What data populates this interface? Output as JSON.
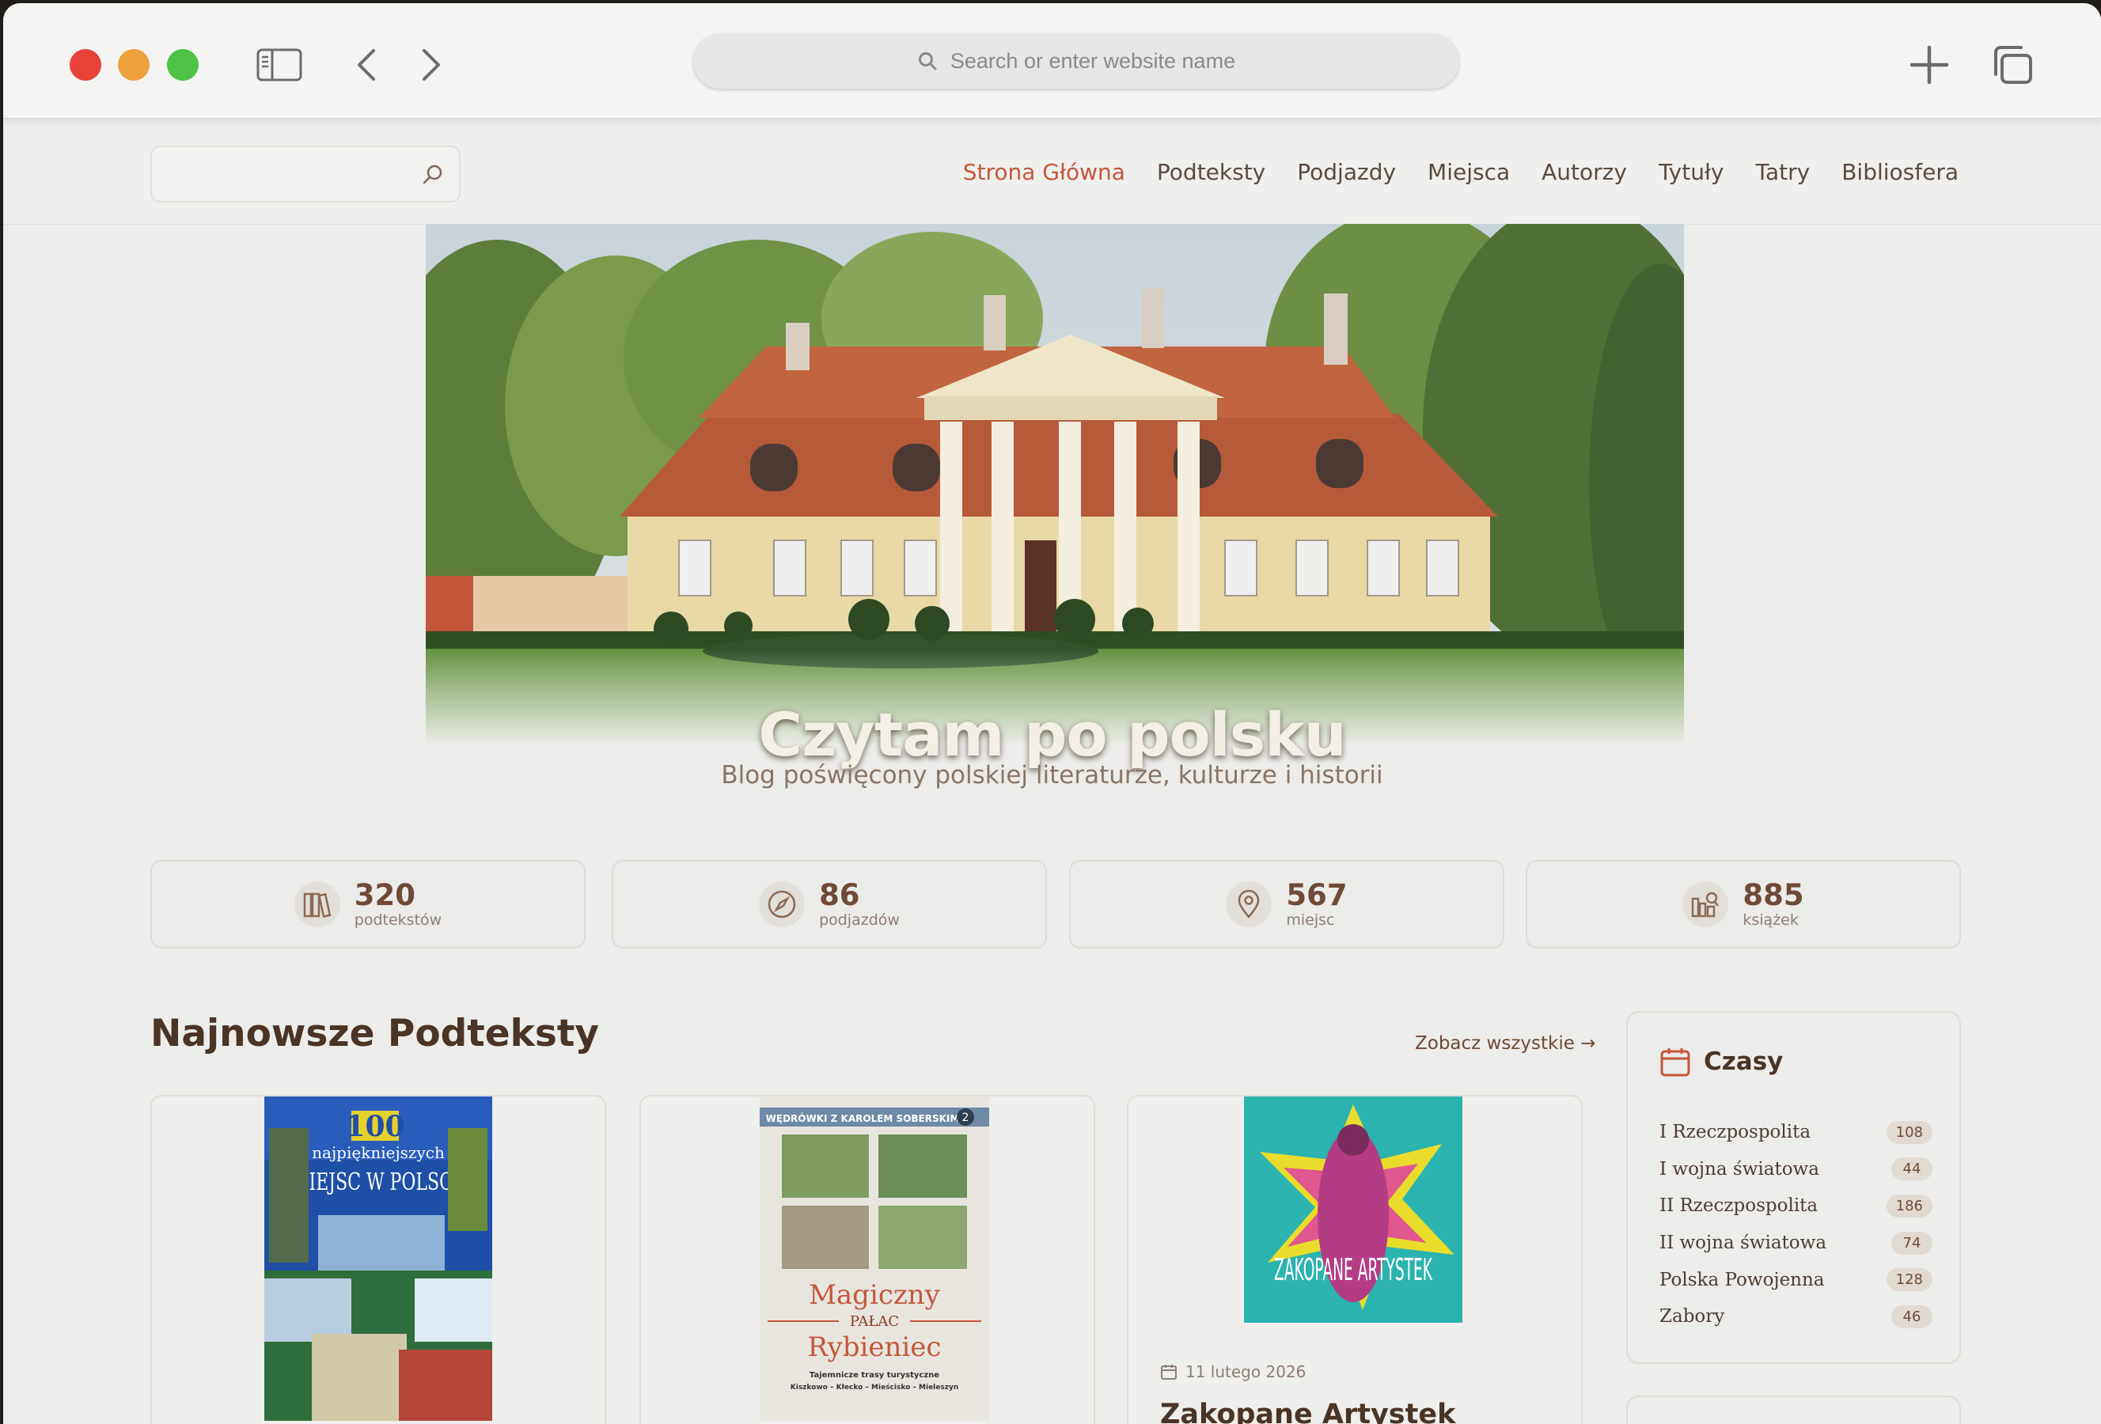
{
  "browser": {
    "url_placeholder": "Search or enter website name"
  },
  "site": {
    "search_placeholder": "",
    "nav": [
      "Strona Główna",
      "Podteksty",
      "Podjazdy",
      "Miejsca",
      "Autorzy",
      "Tytuły",
      "Tatry",
      "Bibliosfera"
    ],
    "active_nav": "Strona Główna",
    "hero_title": "Czytam po polsku",
    "hero_subtitle": "Blog poświęcony polskiej literaturze, kulturze i historii"
  },
  "stats": [
    {
      "icon": "books-icon",
      "value": "320",
      "label": "podtekstów"
    },
    {
      "icon": "compass-icon",
      "value": "86",
      "label": "podjazdów"
    },
    {
      "icon": "map-pin-icon",
      "value": "567",
      "label": "miejsc"
    },
    {
      "icon": "library-search-icon",
      "value": "885",
      "label": "książek"
    }
  ],
  "latest": {
    "title": "Najnowsze Podteksty",
    "see_all": "Zobacz wszystkie →",
    "cards": [
      {
        "cover_title_top": "100",
        "cover_title_mid": "najpiękniejszych",
        "cover_title_main": "MIEJSC W POLSCE"
      },
      {
        "cover_series": "WĘDRÓWKI Z KAROLEM SOBERSKIM",
        "cover_number": "2",
        "cover_title_a": "Magiczny",
        "cover_title_b": "PAŁAC",
        "cover_title_c": "Rybieniec",
        "cover_subtitle": "Tajemnicze trasy turystyczne",
        "cover_route": "Kiszkowo – Kłecko – Mieścisko – Mieleszyn"
      },
      {
        "cover_title": "ZAKOPANE ARTYSTEK",
        "date": "11 lutego 2026",
        "title": "Zakopane Artystek"
      }
    ]
  },
  "sidebar": {
    "title": "Czasy",
    "eras": [
      {
        "name": "I Rzeczpospolita",
        "count": "108"
      },
      {
        "name": "I wojna światowa",
        "count": "44"
      },
      {
        "name": "II Rzeczpospolita",
        "count": "186"
      },
      {
        "name": "II wojna światowa",
        "count": "74"
      },
      {
        "name": "Polska Powojenna",
        "count": "128"
      },
      {
        "name": "Zabory",
        "count": "46"
      }
    ]
  },
  "colors": {
    "accent": "#c5573a",
    "brown": "#6f4a36",
    "background": "#ececea"
  }
}
